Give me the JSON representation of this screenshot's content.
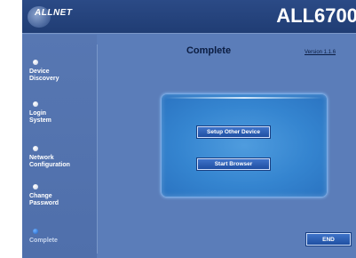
{
  "header": {
    "brand": "ALLNET",
    "model": "ALL6700"
  },
  "sidebar": {
    "items": [
      {
        "label": "Device\nDiscovery",
        "active": false
      },
      {
        "label": "Login\nSystem",
        "active": false
      },
      {
        "label": "Network\nConfiguration",
        "active": false
      },
      {
        "label": "Change\nPassword",
        "active": false
      },
      {
        "label": "Complete",
        "active": true
      }
    ]
  },
  "main": {
    "title": "Complete",
    "version": "Version 1.1.6",
    "buttons": {
      "setup_other": "Setup Other Device",
      "start_browser": "Start Browser"
    },
    "end": "END"
  },
  "colors": {
    "background": "#5b7db9",
    "header": "#203d74",
    "panel": "#3585d0",
    "active_bullet": "#1f62c8"
  }
}
